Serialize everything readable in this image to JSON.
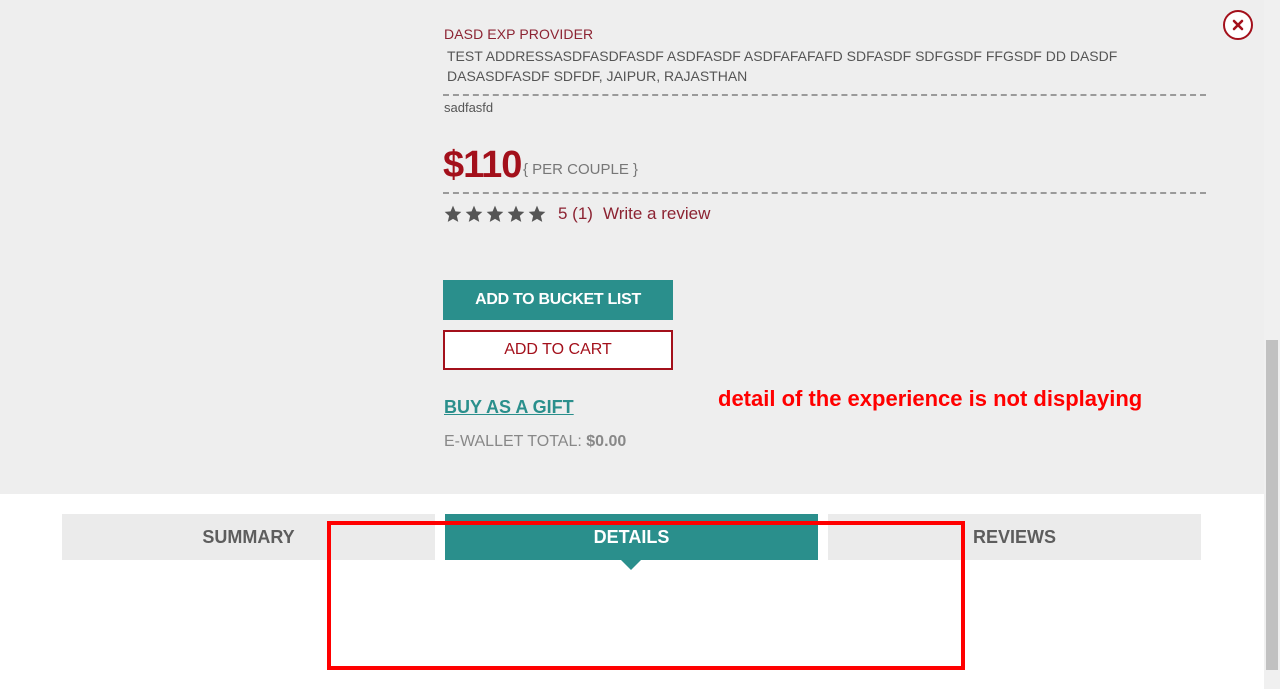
{
  "product": {
    "provider": "DASD EXP PROVIDER",
    "address": "TEST ADDRESSASDFASDFASDF ASDFASDF ASDFAFAFAFD SDFASDF SDFGSDF FFGSDF DD DASDF DASASDFASDF SDFDF, JAIPUR, RAJASTHAN",
    "short_description": "sadfasfd",
    "price": "$110",
    "per_unit": "{ PER COUPLE }",
    "rating": {
      "stars": 5,
      "text": "5 (1)",
      "write_review": "Write a review"
    },
    "add_to_bucket_list": "ADD TO BUCKET LIST",
    "add_to_cart": "ADD TO CART",
    "buy_as_gift": "BUY AS A GIFT",
    "wallet": {
      "label": "E-WALLET TOTAL:",
      "amount": "$0.00"
    }
  },
  "annotation": {
    "text": "detail of the experience is not displaying"
  },
  "tabs": {
    "summary": "SUMMARY",
    "details": "DETAILS",
    "reviews": "REVIEWS",
    "active": "details"
  },
  "colors": {
    "accent_teal": "#2a8f8c",
    "brand_red": "#a3101b",
    "annotation_red": "#ff0000",
    "panel_grey": "#eeeeee"
  },
  "icons": {
    "close": "close-icon",
    "star": "star-icon"
  }
}
